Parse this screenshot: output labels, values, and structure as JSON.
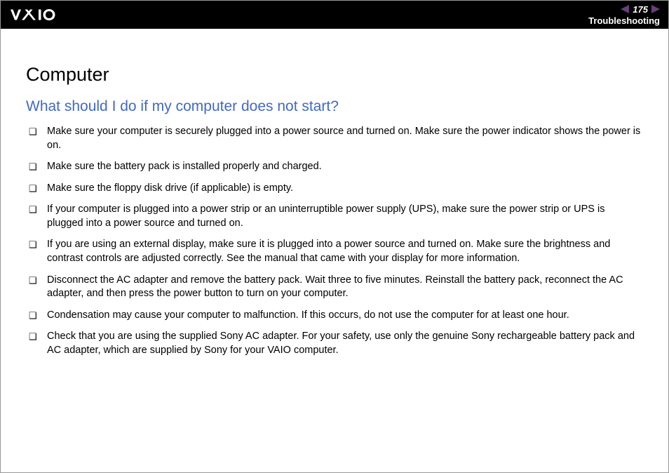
{
  "header": {
    "page_number": "175",
    "section": "Troubleshooting"
  },
  "content": {
    "section_title": "Computer",
    "subsection_title": "What should I do if my computer does not start?",
    "bullets": [
      "Make sure your computer is securely plugged into a power source and turned on. Make sure the power indicator shows the power is on.",
      "Make sure the battery pack is installed properly and charged.",
      "Make sure the floppy disk drive (if applicable) is empty.",
      "If your computer is plugged into a power strip or an uninterruptible power supply (UPS), make sure the power strip or UPS is plugged into a power source and turned on.",
      "If you are using an external display, make sure it is plugged into a power source and turned on. Make sure the brightness and contrast controls are adjusted correctly. See the manual that came with your display for more information.",
      "Disconnect the AC adapter and remove the battery pack. Wait three to five minutes. Reinstall the battery pack, reconnect the AC adapter, and then press the power button to turn on your computer.",
      "Condensation may cause your computer to malfunction. If this occurs, do not use the computer for at least one hour.",
      "Check that you are using the supplied Sony AC adapter. For your safety, use only the genuine Sony rechargeable battery pack and AC adapter, which are supplied by Sony for your VAIO computer."
    ]
  }
}
